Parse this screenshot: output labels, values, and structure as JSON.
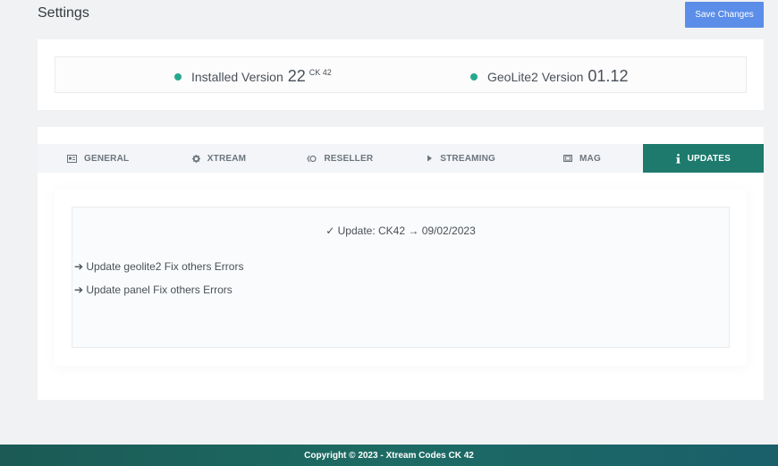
{
  "header": {
    "title": "Settings",
    "save_label": "Save Changes"
  },
  "versions": {
    "installed": {
      "label": "Installed Version",
      "value": "22",
      "suffix": "CK 42",
      "status_color": "#26a98d"
    },
    "geolite": {
      "label": "GeoLite2 Version",
      "value": "01.12",
      "status_color": "#26a98d"
    }
  },
  "tabs": [
    {
      "label": "GENERAL",
      "icon": "id-card-icon"
    },
    {
      "label": "XTREAM",
      "icon": "gear-icon"
    },
    {
      "label": "RESELLER",
      "icon": "reseller-icon"
    },
    {
      "label": "STREAMING",
      "icon": "play-icon"
    },
    {
      "label": "MAG",
      "icon": "tv-icon"
    },
    {
      "label": "UPDATES",
      "icon": "info-icon",
      "active": true
    }
  ],
  "updates": {
    "heading": "✓ Update: CK42 → 09/02/2023",
    "lines": [
      "➔ Update geolite2 Fix others Errors",
      "➔ Update panel Fix others Errors"
    ]
  },
  "footer": {
    "copyright": "Copyright © 2023 - Xtream Codes CK 42"
  },
  "colors": {
    "accent": "#5b8ee8",
    "active_tab": "#1d7a6d",
    "status": "#26a98d"
  }
}
